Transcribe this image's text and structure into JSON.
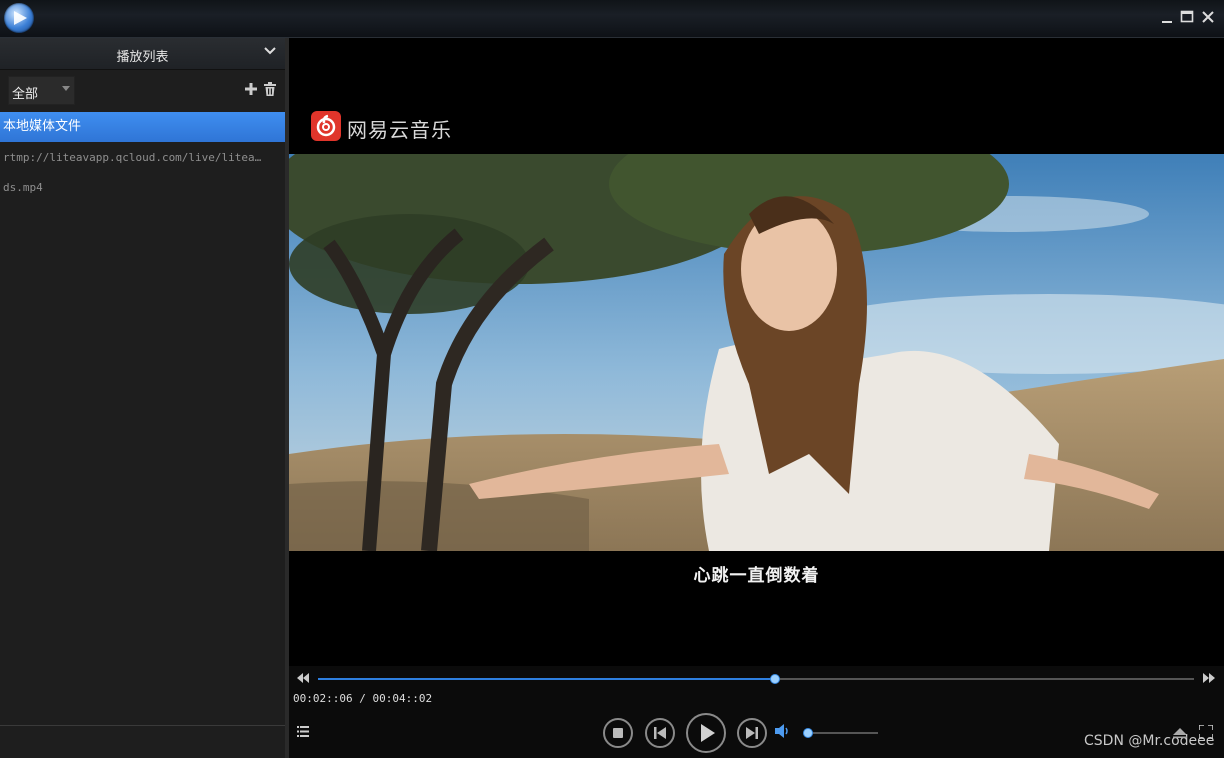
{
  "window": {
    "minimize_icon": "minimize-icon",
    "maximize_icon": "maximize-icon",
    "close_icon": "close-icon"
  },
  "playlist": {
    "title": "播放列表",
    "filter_value": "全部",
    "items": [
      {
        "label": "本地媒体文件",
        "selected": true
      },
      {
        "label": "rtmp://liteavapp.qcloud.com/live/litea…",
        "selected": false
      },
      {
        "label": "ds.mp4",
        "selected": false
      }
    ]
  },
  "video": {
    "watermark_text": "网易云音乐",
    "subtitle": "心跳一直倒数着"
  },
  "player": {
    "current_time": "00:02::06",
    "separator": " / ",
    "total_time": "00:04::02",
    "progress": 0.522,
    "volume": 0.0,
    "accent_color": "#2e7fe0"
  },
  "credit": "CSDN @Mr.codeee"
}
